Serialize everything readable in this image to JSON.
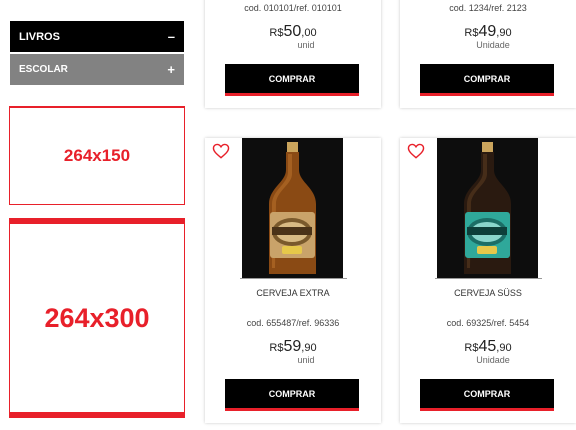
{
  "sidebar": {
    "categories": [
      {
        "label": "LIVROS",
        "toggle": "–"
      },
      {
        "label": "ESCOLAR",
        "toggle": "+"
      }
    ]
  },
  "banners": {
    "small": "264x150",
    "large": "264x300"
  },
  "products_top": [
    {
      "code": "cod. 010101/ref. 010101",
      "currency": "R$",
      "price_int": "50",
      "price_dec": ",00",
      "unit": "unid",
      "buy_label": "COMPRAR"
    },
    {
      "code": "cod. 1234/ref. 2123",
      "currency": "R$",
      "price_int": "49",
      "price_dec": ",90",
      "unit": "Unidade",
      "buy_label": "COMPRAR"
    }
  ],
  "products_bottom": [
    {
      "name": "CERVEJA EXTRA",
      "code": "cod. 655487/ref. 96336",
      "currency": "R$",
      "price_int": "59",
      "price_dec": ",90",
      "unit": "unid",
      "buy_label": "COMPRAR",
      "label_color": "#c9a36a",
      "label_word": "Extra"
    },
    {
      "name": "CERVEJA SÜSS",
      "code": "cod. 69325/ref. 5454",
      "currency": "R$",
      "price_int": "45",
      "price_dec": ",90",
      "unit": "Unidade",
      "buy_label": "COMPRAR",
      "label_color": "#2fa89a",
      "label_word": ""
    }
  ],
  "colors": {
    "accent": "#e8202a",
    "dark": "#000000",
    "sidebar_secondary": "#828282"
  },
  "icons": {
    "favorite": "heart-outline-icon"
  }
}
